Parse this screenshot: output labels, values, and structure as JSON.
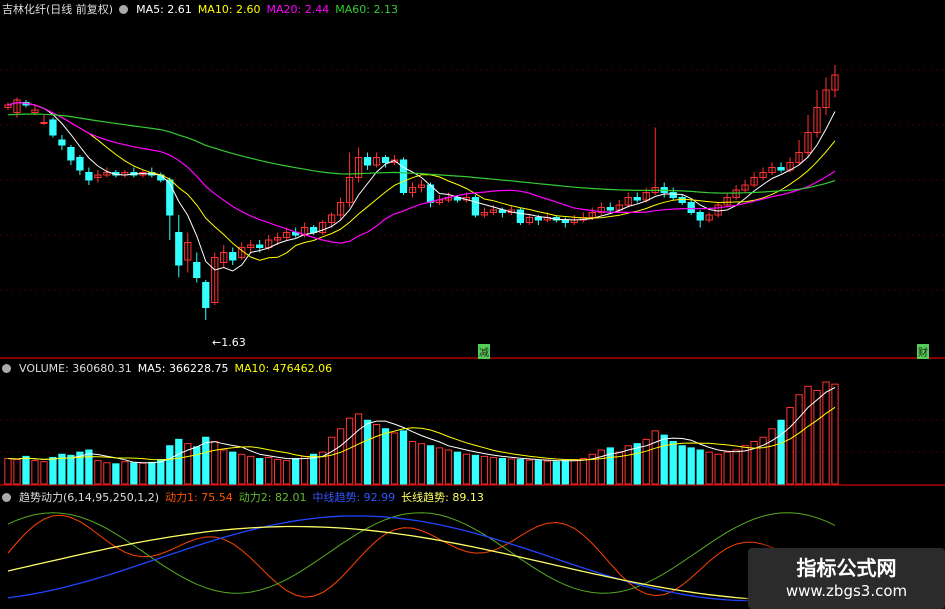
{
  "price_panel": {
    "title": "吉林化纤(日线 前复权)",
    "ma5": "MA5: 2.61",
    "ma10": "MA10: 2.60",
    "ma20": "MA20: 2.44",
    "ma60": "MA60: 2.13",
    "low_mark": "1.63",
    "marker_mid": "减",
    "marker_right": "财"
  },
  "volume_panel": {
    "title": "VOLUME: 360680.31",
    "ma5": "MA5: 366228.75",
    "ma10": "MA10: 476462.06"
  },
  "indicator_panel": {
    "title": "趋势动力(6,14,95,250,1,2)",
    "dongli1": "动力1: 75.54",
    "dongli2": "动力2: 82.01",
    "mid_trend": "中线趋势: 92.99",
    "long_trend": "长线趋势: 89.13"
  },
  "watermark": {
    "line1": "指标公式网",
    "line2": "www.zbgs3.com"
  },
  "colors": {
    "up": "#ff3333",
    "down": "#33ffff",
    "ma5": "#ffffff",
    "ma10": "#ffff00",
    "ma20": "#ff00ff",
    "ma60": "#33cc33",
    "grid": "#800000",
    "dongli1": "#ff4400",
    "dongli2": "#55aa22",
    "mid_trend": "#2244ff",
    "long_trend": "#ffff66"
  },
  "chart_data": {
    "type": "candlestick",
    "candles": [
      [
        2.48,
        2.49,
        2.47,
        2.5
      ],
      [
        2.46,
        2.51,
        2.44,
        2.52
      ],
      [
        2.5,
        2.49,
        2.48,
        2.51
      ],
      [
        2.46,
        2.47,
        2.45,
        2.49
      ],
      [
        2.42,
        2.42,
        2.41,
        2.45
      ],
      [
        2.43,
        2.37,
        2.36,
        2.44
      ],
      [
        2.35,
        2.33,
        2.31,
        2.37
      ],
      [
        2.32,
        2.27,
        2.25,
        2.33
      ],
      [
        2.28,
        2.23,
        2.21,
        2.29
      ],
      [
        2.22,
        2.19,
        2.17,
        2.24
      ],
      [
        2.2,
        2.21,
        2.18,
        2.23
      ],
      [
        2.21,
        2.22,
        2.2,
        2.24
      ],
      [
        2.22,
        2.21,
        2.2,
        2.23
      ],
      [
        2.21,
        2.22,
        2.2,
        2.23
      ],
      [
        2.22,
        2.21,
        2.2,
        2.24
      ],
      [
        2.21,
        2.22,
        2.2,
        2.23
      ],
      [
        2.22,
        2.21,
        2.2,
        2.24
      ],
      [
        2.21,
        2.19,
        2.18,
        2.22
      ],
      [
        2.19,
        2.05,
        1.95,
        2.2
      ],
      [
        1.98,
        1.85,
        1.8,
        2.05
      ],
      [
        1.87,
        1.94,
        1.82,
        1.98
      ],
      [
        1.86,
        1.8,
        1.78,
        1.9
      ],
      [
        1.78,
        1.68,
        1.63,
        1.79
      ],
      [
        1.7,
        1.88,
        1.69,
        1.9
      ],
      [
        1.86,
        1.9,
        1.84,
        1.93
      ],
      [
        1.9,
        1.87,
        1.85,
        1.92
      ],
      [
        1.88,
        1.92,
        1.87,
        1.94
      ],
      [
        1.92,
        1.93,
        1.9,
        1.95
      ],
      [
        1.93,
        1.92,
        1.9,
        1.95
      ],
      [
        1.92,
        1.95,
        1.91,
        1.97
      ],
      [
        1.95,
        1.96,
        1.93,
        1.98
      ],
      [
        1.96,
        1.98,
        1.95,
        2.0
      ],
      [
        1.98,
        1.97,
        1.96,
        2.0
      ],
      [
        1.97,
        2.0,
        1.96,
        2.02
      ],
      [
        2.0,
        1.98,
        1.97,
        2.01
      ],
      [
        1.98,
        2.02,
        1.97,
        2.03
      ],
      [
        2.02,
        2.05,
        2.0,
        2.06
      ],
      [
        2.05,
        2.1,
        2.03,
        2.12
      ],
      [
        2.1,
        2.2,
        2.08,
        2.3
      ],
      [
        2.2,
        2.28,
        2.18,
        2.32
      ],
      [
        2.28,
        2.25,
        2.23,
        2.3
      ],
      [
        2.25,
        2.28,
        2.24,
        2.3
      ],
      [
        2.28,
        2.26,
        2.24,
        2.29
      ],
      [
        2.26,
        2.27,
        2.25,
        2.29
      ],
      [
        2.27,
        2.14,
        2.13,
        2.28
      ],
      [
        2.14,
        2.16,
        2.12,
        2.18
      ],
      [
        2.16,
        2.17,
        2.14,
        2.19
      ],
      [
        2.17,
        2.1,
        2.08,
        2.18
      ],
      [
        2.1,
        2.11,
        2.09,
        2.13
      ],
      [
        2.11,
        2.12,
        2.1,
        2.14
      ],
      [
        2.12,
        2.11,
        2.1,
        2.13
      ],
      [
        2.11,
        2.12,
        2.1,
        2.14
      ],
      [
        2.12,
        2.05,
        2.04,
        2.13
      ],
      [
        2.05,
        2.06,
        2.04,
        2.08
      ],
      [
        2.06,
        2.07,
        2.05,
        2.09
      ],
      [
        2.07,
        2.06,
        2.04,
        2.08
      ],
      [
        2.06,
        2.07,
        2.05,
        2.09
      ],
      [
        2.07,
        2.02,
        2.01,
        2.08
      ],
      [
        2.02,
        2.04,
        2.01,
        2.05
      ],
      [
        2.04,
        2.03,
        2.01,
        2.05
      ],
      [
        2.03,
        2.04,
        2.02,
        2.06
      ],
      [
        2.04,
        2.03,
        2.02,
        2.05
      ],
      [
        2.03,
        2.02,
        2.0,
        2.04
      ],
      [
        2.02,
        2.03,
        2.01,
        2.05
      ],
      [
        2.03,
        2.04,
        2.02,
        2.06
      ],
      [
        2.04,
        2.06,
        2.03,
        2.08
      ],
      [
        2.06,
        2.08,
        2.05,
        2.1
      ],
      [
        2.08,
        2.07,
        2.06,
        2.1
      ],
      [
        2.07,
        2.09,
        2.06,
        2.11
      ],
      [
        2.09,
        2.12,
        2.08,
        2.14
      ],
      [
        2.12,
        2.11,
        2.1,
        2.14
      ],
      [
        2.11,
        2.14,
        2.1,
        2.16
      ],
      [
        2.14,
        2.16,
        2.13,
        2.4
      ],
      [
        2.16,
        2.14,
        2.12,
        2.18
      ],
      [
        2.14,
        2.12,
        2.11,
        2.16
      ],
      [
        2.12,
        2.1,
        2.09,
        2.13
      ],
      [
        2.1,
        2.06,
        2.05,
        2.11
      ],
      [
        2.06,
        2.03,
        2.0,
        2.07
      ],
      [
        2.03,
        2.05,
        2.02,
        2.06
      ],
      [
        2.05,
        2.09,
        2.04,
        2.1
      ],
      [
        2.09,
        2.12,
        2.08,
        2.14
      ],
      [
        2.12,
        2.15,
        2.11,
        2.17
      ],
      [
        2.15,
        2.17,
        2.14,
        2.19
      ],
      [
        2.17,
        2.2,
        2.16,
        2.22
      ],
      [
        2.2,
        2.22,
        2.19,
        2.24
      ],
      [
        2.22,
        2.24,
        2.21,
        2.26
      ],
      [
        2.24,
        2.23,
        2.22,
        2.26
      ],
      [
        2.23,
        2.26,
        2.22,
        2.28
      ],
      [
        2.26,
        2.3,
        2.25,
        2.35
      ],
      [
        2.3,
        2.38,
        2.28,
        2.45
      ],
      [
        2.38,
        2.48,
        2.36,
        2.55
      ],
      [
        2.48,
        2.55,
        2.45,
        2.6
      ],
      [
        2.55,
        2.61,
        2.52,
        2.65
      ]
    ],
    "volumes": [
      120,
      115,
      130,
      110,
      105,
      125,
      140,
      135,
      150,
      160,
      110,
      100,
      95,
      105,
      100,
      98,
      102,
      115,
      180,
      210,
      190,
      175,
      220,
      200,
      160,
      150,
      140,
      130,
      120,
      125,
      115,
      110,
      120,
      130,
      140,
      150,
      220,
      260,
      310,
      330,
      300,
      280,
      260,
      240,
      250,
      200,
      190,
      180,
      170,
      160,
      150,
      140,
      135,
      130,
      125,
      120,
      118,
      115,
      112,
      110,
      108,
      105,
      110,
      115,
      120,
      140,
      160,
      170,
      150,
      180,
      190,
      210,
      250,
      230,
      200,
      180,
      170,
      160,
      150,
      140,
      150,
      160,
      180,
      200,
      220,
      260,
      300,
      360,
      420,
      460,
      440,
      480,
      470
    ],
    "ma_legend": [
      "MA5",
      "MA10",
      "MA20",
      "MA60"
    ],
    "ma_values": [
      2.61,
      2.6,
      2.44,
      2.13
    ],
    "low": 1.63,
    "volume_legend": [
      {
        "name": "VOLUME",
        "value": 360680.31
      },
      {
        "name": "MA5",
        "value": 366228.75
      },
      {
        "name": "MA10",
        "value": 476462.06
      }
    ],
    "indicator": {
      "name": "趋势动力",
      "params": [
        6,
        14,
        95,
        250,
        1,
        2
      ],
      "dongli1": 75.54,
      "dongli2": 82.01,
      "mid_trend": 92.99,
      "long_trend": 89.13
    }
  }
}
